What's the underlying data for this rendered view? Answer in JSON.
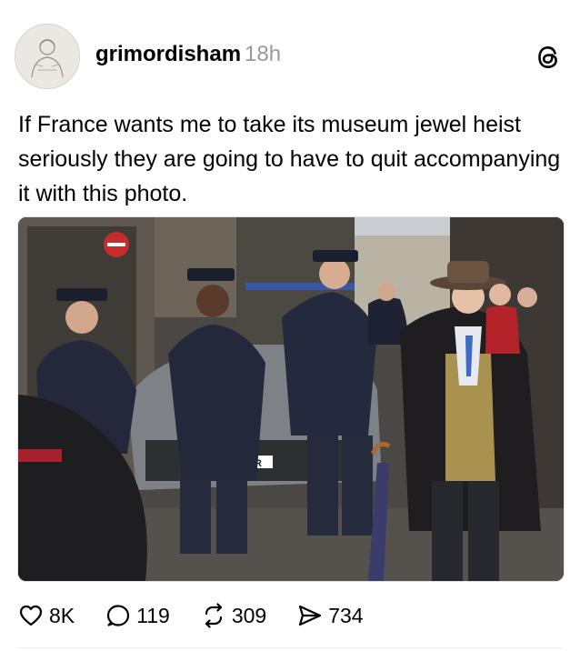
{
  "post": {
    "author": {
      "username": "grimordisham",
      "time": "18h"
    },
    "text": "If France wants me to take its museum jewel heist seriously they are going to have to quit accompanying it with this photo.",
    "photo": {
      "plate_text": "9-MR"
    },
    "actions": {
      "likes": "8K",
      "replies": "119",
      "reposts": "309",
      "shares": "734"
    }
  },
  "icons": {
    "platform": "threads-logo-icon",
    "like": "heart-icon",
    "reply": "comment-bubble-icon",
    "repost": "repost-arrows-icon",
    "share": "send-icon"
  },
  "colors": {
    "timestamp": "#999999",
    "text": "#000000",
    "background": "#ffffff"
  }
}
